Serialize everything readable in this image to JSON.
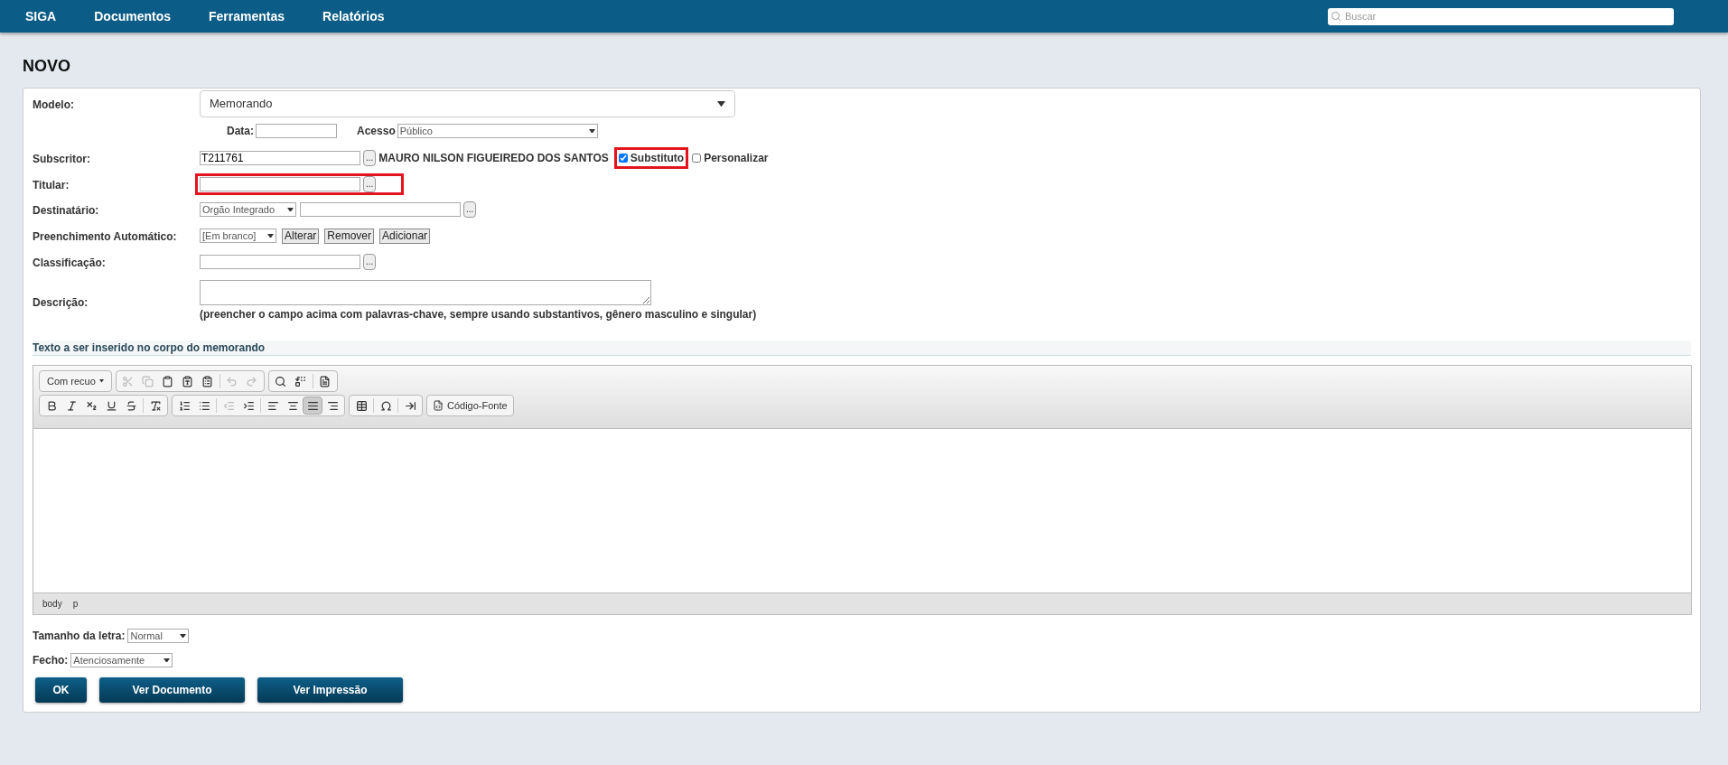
{
  "nav": {
    "items": [
      "SIGA",
      "Documentos",
      "Ferramentas",
      "Relatórios"
    ],
    "search": {
      "placeholder": "Buscar"
    }
  },
  "title": "NOVO",
  "form": {
    "modelo": {
      "label": "Modelo:",
      "value": "Memorando"
    },
    "data": {
      "label": "Data:"
    },
    "acesso": {
      "label": "Acesso",
      "value": "Público"
    },
    "subscritor": {
      "label": "Subscritor:",
      "value": "T211761",
      "name": "MAURO NILSON FIGUEIREDO DOS SANTOS",
      "lookup": "...",
      "substituto": {
        "label": "Substituto",
        "checked": true,
        "highlighted": true
      },
      "personalizar": {
        "label": "Personalizar",
        "checked": false
      }
    },
    "titular": {
      "label": "Titular:",
      "lookup": "...",
      "highlighted": true
    },
    "destinatario": {
      "label": "Destinatário:",
      "type": "Orgão Integrado",
      "lookup": "..."
    },
    "preenchimento": {
      "label": "Preenchimento Automático:",
      "value": "[Em branco]",
      "buttons": [
        "Alterar",
        "Remover",
        "Adicionar"
      ]
    },
    "classificacao": {
      "label": "Classificação:",
      "lookup": "..."
    },
    "descricao": {
      "label": "Descrição:",
      "hint": "(preencher o campo acima com palavras-chave, sempre usando substantivos, gênero masculino e singular)"
    }
  },
  "editor": {
    "section": "Texto a ser inserido no corpo do memorando",
    "format": "Com recuo",
    "source": "Código-Fonte",
    "tools": [
      {
        "disabled": true,
        "selected": false
      },
      {
        "disabled": true,
        "selected": false
      },
      {
        "disabled": false,
        "selected": false
      },
      {
        "disabled": false,
        "selected": false
      },
      {
        "disabled": false,
        "selected": false
      },
      {
        "disabled": true,
        "selected": false
      },
      {
        "disabled": true,
        "selected": false
      },
      {
        "disabled": false,
        "selected": false
      },
      {
        "disabled": false,
        "selected": false
      },
      {
        "disabled": false,
        "selected": false
      },
      {
        "disabled": false,
        "selected": false
      },
      {
        "disabled": false,
        "selected": false
      },
      {
        "disabled": false,
        "selected": false
      },
      {
        "disabled": false,
        "selected": false
      },
      {
        "disabled": false,
        "selected": false
      },
      {
        "disabled": false,
        "selected": false
      },
      {
        "disabled": false,
        "selected": false
      },
      {
        "disabled": false,
        "selected": false
      },
      {
        "disabled": true,
        "selected": false
      },
      {
        "disabled": false,
        "selected": false
      },
      {
        "disabled": false,
        "selected": false
      },
      {
        "disabled": false,
        "selected": false
      },
      {
        "disabled": false,
        "selected": true
      },
      {
        "disabled": false,
        "selected": false
      },
      {
        "disabled": false,
        "selected": false
      },
      {
        "disabled": false,
        "selected": false
      },
      {
        "disabled": false,
        "selected": false
      }
    ],
    "path": [
      "body",
      "p"
    ]
  },
  "tamanho": {
    "label": "Tamanho da letra:",
    "value": "Normal"
  },
  "fecho": {
    "label": "Fecho:",
    "value": "Atenciosamente"
  },
  "actions": [
    "OK",
    "Ver Documento",
    "Ver Impressão"
  ]
}
